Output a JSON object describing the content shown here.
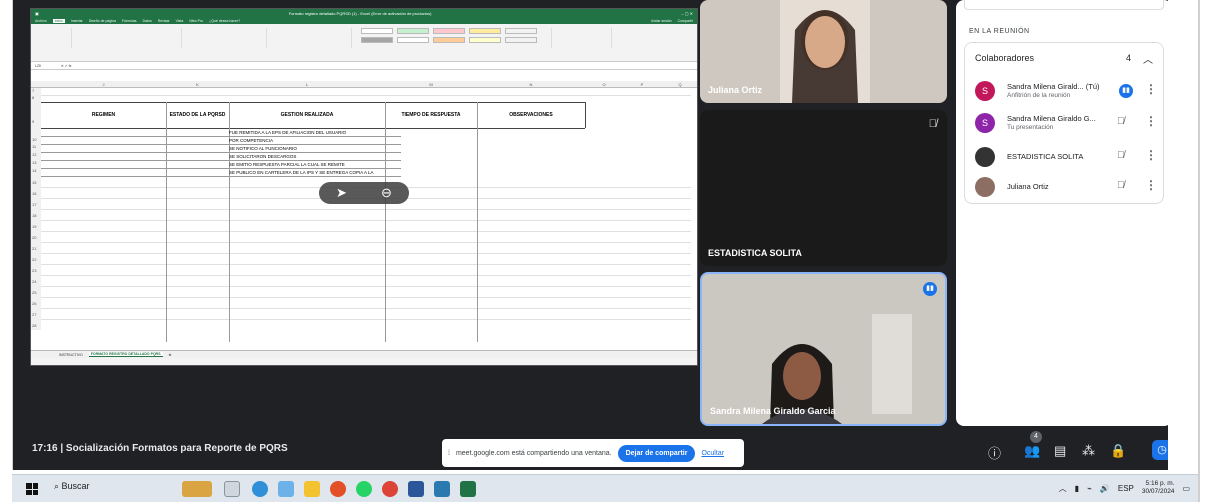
{
  "excel": {
    "title": "Formato registro detallado PQRSD (1) - Excel (Error de activación de productos)",
    "ribbon_tabs": [
      "Archivo",
      "Inicio",
      "Insertar",
      "Diseño de página",
      "Fórmulas",
      "Datos",
      "Revisar",
      "Vista",
      "Nitro Pro",
      "¿Qué desea hacer?"
    ],
    "signin": "Iniciar sesión",
    "share": "Compartir",
    "name_box": "L20",
    "columns": [
      "J",
      "K",
      "L",
      "M",
      "N",
      "O",
      "P",
      "Q"
    ],
    "headers": [
      "REGIMEN",
      "ESTADO DE LA PQRSD",
      "GESTION REALIZADA",
      "TIEMPO DE RESPUESTA",
      "OBSERVACIONES"
    ],
    "rows": [
      "7",
      "8",
      "9",
      "10",
      "11",
      "12",
      "13",
      "14",
      "15",
      "16",
      "17",
      "18",
      "19",
      "20",
      "21",
      "22",
      "23",
      "24",
      "25",
      "26",
      "27",
      "28"
    ],
    "gestion": [
      "FUE REMITIDA A LA EPS DE AFILIACION DEL USUARIO",
      "POR COMPETENCIA",
      "SE NOTIFICO AL FUNCIONARIO",
      "SE SOLICITARON DESCARGOS",
      "SE EMITIO RESPUESTA PARCIAL LA CUAL SE REMITE",
      "SE PUBLICO EN CARTELERA DE LA IPS Y SE ENTREGA COPIA A LA"
    ],
    "sheet_tabs": [
      "INSTRUCTIVO",
      "FORMATO REGISTRO DETALLADO PQRS"
    ],
    "zoom_minus": "⊖"
  },
  "tiles": [
    {
      "name": "Juliana Ortiz"
    },
    {
      "name": "ESTADISTICA SOLITA"
    },
    {
      "name": "Sandra Milena Giraldo Garcia"
    }
  ],
  "panel": {
    "section": "EN LA REUNIÓN",
    "collab_label": "Colaboradores",
    "collab_count": "4",
    "people": [
      {
        "name": "Sandra Milena Girald... (Tú)",
        "sub": "Anfitrión de la reunión",
        "initial": "S",
        "color": "#c2185b"
      },
      {
        "name": "Sandra Milena Giraldo G...",
        "sub": "Tu presentación",
        "initial": "S",
        "color": "#8e24aa"
      },
      {
        "name": "ESTADISTICA SOLITA",
        "sub": "",
        "initial": "",
        "color": "#333333"
      },
      {
        "name": "Juliana Ortiz",
        "sub": "",
        "initial": "",
        "color": "#8d6e63"
      }
    ]
  },
  "bottom": {
    "title": "17:16  |  Socialización Formatos para Reporte de PQRS",
    "share_msg": "meet.google.com está compartiendo una ventana.",
    "stop_share": "Dejar de compartir",
    "hide": "Ocultar",
    "people_count": "4"
  },
  "taskbar": {
    "search": "Buscar",
    "lang": "ESP",
    "time": "5:16 p. m.",
    "date": "30/07/2024"
  }
}
